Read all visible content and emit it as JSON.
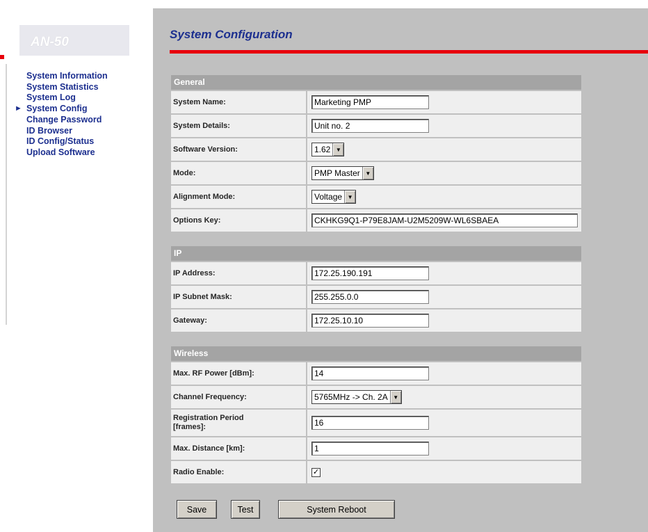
{
  "brand": {
    "logo_text": "AN-50"
  },
  "nav": {
    "items": [
      {
        "label": "System Information",
        "active": false
      },
      {
        "label": "System Statistics",
        "active": false
      },
      {
        "label": "System Log",
        "active": false
      },
      {
        "label": "System Config",
        "active": true
      },
      {
        "label": "Change Password",
        "active": false
      },
      {
        "label": "ID Browser",
        "active": false
      },
      {
        "label": "ID Config/Status",
        "active": false
      },
      {
        "label": "Upload Software",
        "active": false
      }
    ]
  },
  "page": {
    "title": "System Configuration"
  },
  "general": {
    "header": "General",
    "system_name": {
      "label": "System Name:",
      "value": "Marketing PMP"
    },
    "system_details": {
      "label": "System Details:",
      "value": "Unit no. 2"
    },
    "software_version": {
      "label": "Software Version:",
      "value": "1.62"
    },
    "mode": {
      "label": "Mode:",
      "value": "PMP Master"
    },
    "alignment_mode": {
      "label": "Alignment Mode:",
      "value": "Voltage"
    },
    "options_key": {
      "label": "Options Key:",
      "value": "CKHKG9Q1-P79E8JAM-U2M5209W-WL6SBAEA"
    }
  },
  "ip": {
    "header": "IP",
    "ip_address": {
      "label": "IP Address:",
      "value": "172.25.190.191"
    },
    "subnet_mask": {
      "label": "IP Subnet Mask:",
      "value": "255.255.0.0"
    },
    "gateway": {
      "label": "Gateway:",
      "value": "172.25.10.10"
    }
  },
  "wireless": {
    "header": "Wireless",
    "max_rf_power": {
      "label": "Max. RF Power [dBm]:",
      "value": "14"
    },
    "channel_frequency": {
      "label": "Channel Frequency:",
      "value": "5765MHz -> Ch. 2A"
    },
    "registration_period": {
      "label_line1": "Registration Period",
      "label_line2": "[frames]:",
      "value": "16"
    },
    "max_distance": {
      "label": "Max. Distance [km]:",
      "value": "1"
    },
    "radio_enable": {
      "label": "Radio Enable:",
      "checked": true,
      "check_glyph": "✓"
    }
  },
  "buttons": {
    "save": "Save",
    "test": "Test",
    "reboot": "System Reboot"
  },
  "icons": {
    "active_arrow": "►",
    "dropdown_arrow": "▼"
  },
  "colors": {
    "accent_red": "#e8000b",
    "nav_blue": "#1c2f8f",
    "panel_gray": "#c0c0c0",
    "header_gray": "#a4a4a4"
  }
}
